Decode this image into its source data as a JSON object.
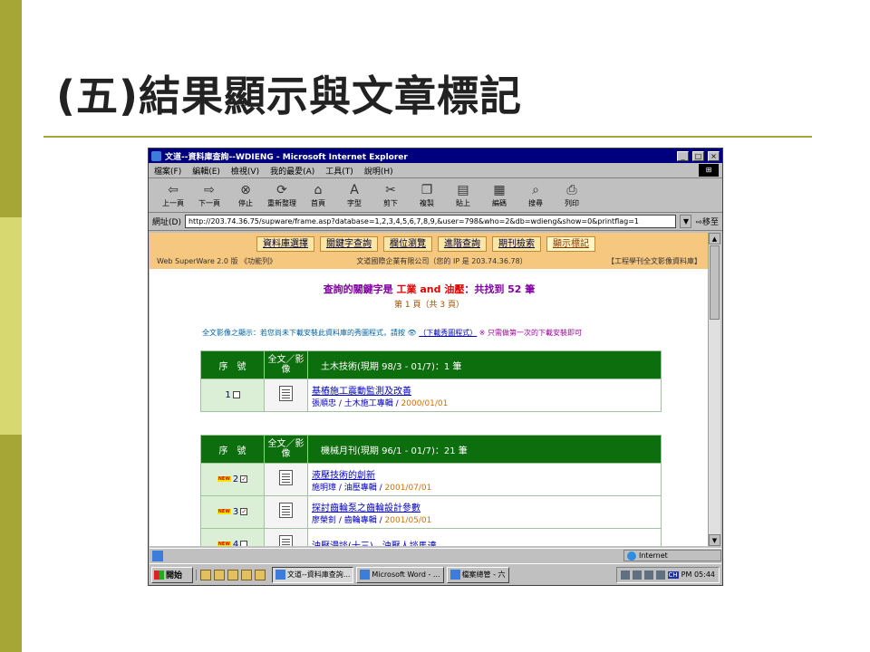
{
  "slide": {
    "title": "(五)結果顯示與文章標記"
  },
  "window": {
    "title": "文道--資料庫查詢--WDIENG - Microsoft Internet Explorer",
    "controls": [
      "_",
      "□",
      "×"
    ],
    "menu": [
      "檔案(F)",
      "編輯(E)",
      "檢視(V)",
      "我的最愛(A)",
      "工具(T)",
      "說明(H)"
    ],
    "toolbar": [
      {
        "label": "上一頁",
        "icon": "back-icon",
        "glyph": "⇦"
      },
      {
        "label": "下一頁",
        "icon": "forward-icon",
        "glyph": "⇨"
      },
      {
        "label": "停止",
        "icon": "stop-icon",
        "glyph": "⊗"
      },
      {
        "label": "重新整理",
        "icon": "refresh-icon",
        "glyph": "⟳"
      },
      {
        "label": "首頁",
        "icon": "home-icon",
        "glyph": "⌂"
      },
      {
        "label": "字型",
        "icon": "font-icon",
        "glyph": "A"
      },
      {
        "label": "剪下",
        "icon": "cut-icon",
        "glyph": "✂"
      },
      {
        "label": "複製",
        "icon": "copy-icon",
        "glyph": "❐"
      },
      {
        "label": "貼上",
        "icon": "paste-icon",
        "glyph": "▤"
      },
      {
        "label": "編碼",
        "icon": "encoding-icon",
        "glyph": "▦"
      },
      {
        "label": "搜尋",
        "icon": "search-icon",
        "glyph": "⌕"
      },
      {
        "label": "列印",
        "icon": "print-icon",
        "glyph": "⎙"
      }
    ],
    "address": {
      "label": "網址(D)",
      "value": "http://203.74.36.75/supware/frame.asp?database=1,2,3,4,5,6,7,8,9,&user=798&who=2&db=wdieng&show=0&printflag=1",
      "go": "移至"
    }
  },
  "page": {
    "nav_tabs": [
      {
        "label": "資料庫選擇",
        "selected": false
      },
      {
        "label": "關鍵字查詢",
        "selected": false
      },
      {
        "label": "欄位瀏覽",
        "selected": false
      },
      {
        "label": "進階查詢",
        "selected": false
      },
      {
        "label": "期刊檢索",
        "selected": false
      },
      {
        "label": "顯示標記",
        "selected": true
      }
    ],
    "nav_left": "Web SuperWare 2.0 版 《功能列》",
    "nav_mid": "文道國際企業有限公司（您的 IP 是 203.74.36.78）",
    "nav_right": "【工程學刊全文影像資料庫】",
    "query_prefix": "查詢的關鍵字是",
    "query_keywords": "工業 and 油壓",
    "query_suffix": "：共找到 52 筆",
    "page_info": "第 1 頁（共 3 頁）",
    "dl_note_prefix": "全文影像之顯示：若您尚未下載安裝此資料庫的秀圖程式，請按",
    "dl_link": "（下載秀圖程式）",
    "dl_note_suffix": "※ 只需做第一次的下載安裝即可",
    "groups": [
      {
        "header_seq": "序　號",
        "header_full": "全文／影像",
        "header_title": "土木技術(現期 98/3 - 01/7)：1 筆",
        "rows": [
          {
            "num": "1",
            "new": false,
            "checked": false,
            "title": "基樁施工震動監測及改善",
            "author": "張順忠 / 土木施工專輯 /",
            "date": "2000/01/01"
          }
        ]
      },
      {
        "header_seq": "序　號",
        "header_full": "全文／影像",
        "header_title": "機械月刊(現期 96/1 - 01/7)：21 筆",
        "rows": [
          {
            "num": "2",
            "new": true,
            "checked": true,
            "title": "液壓技術的創新",
            "author": "施明璋 / 油壓專輯 /",
            "date": "2001/07/01"
          },
          {
            "num": "3",
            "new": true,
            "checked": true,
            "title": "探討齒輪泵之齒輪設計參數",
            "author": "廖榮釗 / 齒輪專輯 /",
            "date": "2001/05/01"
          },
          {
            "num": "4",
            "new": true,
            "checked": false,
            "title": "油壓漫談(十三)—油壓人談馬達",
            "author": "",
            "date": ""
          }
        ]
      }
    ],
    "new_badge": "NEW",
    "check_mark": "✓"
  },
  "status": {
    "zone": "Internet"
  },
  "taskbar": {
    "start": "開始",
    "tasks": [
      {
        "label": "文道--資料庫查詢...",
        "active": true
      },
      {
        "label": "Microsoft Word - ...",
        "active": false
      },
      {
        "label": "檔案總管 - 六",
        "active": false
      }
    ],
    "tray_lang": "CH",
    "clock": "PM 05:44"
  }
}
